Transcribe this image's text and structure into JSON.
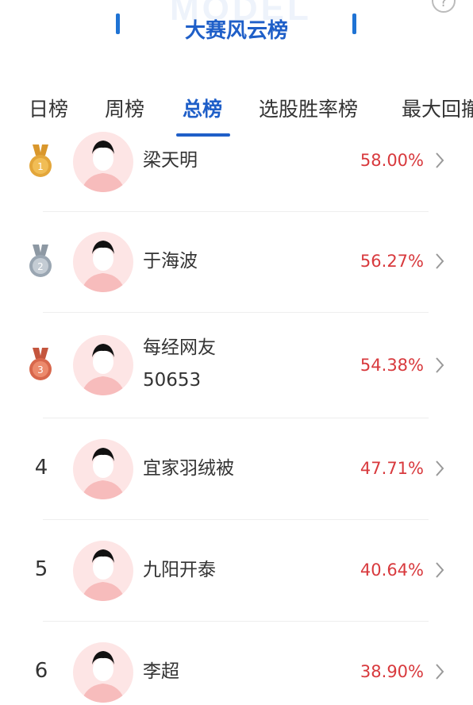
{
  "header": {
    "watermark": "MODEL",
    "title": "大赛风云榜",
    "help_icon": "question-icon"
  },
  "tabs": [
    {
      "label": "日榜",
      "active": false
    },
    {
      "label": "周榜",
      "active": false
    },
    {
      "label": "总榜",
      "active": true
    },
    {
      "label": "选股胜率榜",
      "active": false
    },
    {
      "label": "最大回撤",
      "active": false
    }
  ],
  "rows": [
    {
      "rank": "1",
      "medal": "gold-medal-icon",
      "name_line1": "梁天明",
      "name_line2": "",
      "pct": "58.00%"
    },
    {
      "rank": "2",
      "medal": "silver-medal-icon",
      "name_line1": "于海波",
      "name_line2": "",
      "pct": "56.27%"
    },
    {
      "rank": "3",
      "medal": "bronze-medal-icon",
      "name_line1": "每经网友",
      "name_line2": "50653",
      "pct": "54.38%"
    },
    {
      "rank": "4",
      "medal": "",
      "name_line1": "宜家羽绒被",
      "name_line2": "",
      "pct": "47.71%"
    },
    {
      "rank": "5",
      "medal": "",
      "name_line1": "九阳开泰",
      "name_line2": "",
      "pct": "40.64%"
    },
    {
      "rank": "6",
      "medal": "",
      "name_line1": "李超",
      "name_line2": "",
      "pct": "38.90%"
    }
  ],
  "colors": {
    "accent": "#1f5fc8",
    "percent": "#d8393d",
    "gold": "#e3a63a",
    "silver": "#9aa6b2",
    "bronze": "#d8674c"
  }
}
